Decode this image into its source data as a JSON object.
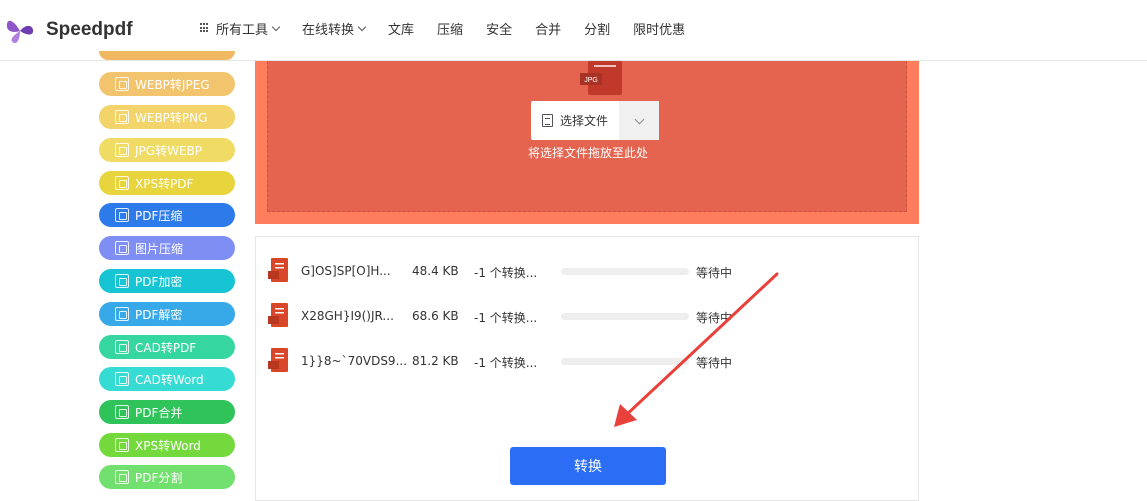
{
  "header": {
    "logo_text": "Speedpdf",
    "nav": [
      {
        "label": "所有工具",
        "dropdown": true,
        "icon": "grid-icon"
      },
      {
        "label": "在线转换",
        "dropdown": true
      },
      {
        "label": "文库"
      },
      {
        "label": "压缩"
      },
      {
        "label": "安全"
      },
      {
        "label": "合并"
      },
      {
        "label": "分割"
      },
      {
        "label": "限时优惠"
      }
    ]
  },
  "sidebar": {
    "items": [
      {
        "label": "WEBP转JPEG",
        "color": "#f2c46d"
      },
      {
        "label": "WEBP转PNG",
        "color": "#f2d46a"
      },
      {
        "label": "JPG转WEBP",
        "color": "#f0dc64"
      },
      {
        "label": "XPS转PDF",
        "color": "#e8d43c"
      },
      {
        "label": "PDF压缩",
        "color": "#2d7bea"
      },
      {
        "label": "图片压缩",
        "color": "#7e8ef2"
      },
      {
        "label": "PDF加密",
        "color": "#16c4d4"
      },
      {
        "label": "PDF解密",
        "color": "#38a9e8"
      },
      {
        "label": "CAD转PDF",
        "color": "#35d6a0"
      },
      {
        "label": "CAD转Word",
        "color": "#36dbd3"
      },
      {
        "label": "PDF合并",
        "color": "#2fc35a"
      },
      {
        "label": "XPS转Word",
        "color": "#74d93c"
      },
      {
        "label": "PDF分割",
        "color": "#72e06e"
      }
    ]
  },
  "upload": {
    "doc_label": "JPG",
    "choose_label": "选择文件",
    "drop_hint": "将选择文件拖放至此处",
    "bg_color": "#e4644f"
  },
  "files": [
    {
      "name": "G]OS]SP[O]H...",
      "size": "48.4 KB",
      "status": "-1 个转换...",
      "state": "等待中",
      "progress": 0
    },
    {
      "name": "X28GH}I9()JR...",
      "size": "68.6 KB",
      "status": "-1 个转换...",
      "state": "等待中",
      "progress": 0
    },
    {
      "name": "1}}8~`70VDS9...",
      "size": "81.2 KB",
      "status": "-1 个转换...",
      "state": "等待中",
      "progress": 0
    }
  ],
  "convert_button": {
    "label": "转换",
    "color": "#2b6ef5"
  },
  "annotation": {
    "type": "arrow",
    "color": "#e8403a"
  }
}
